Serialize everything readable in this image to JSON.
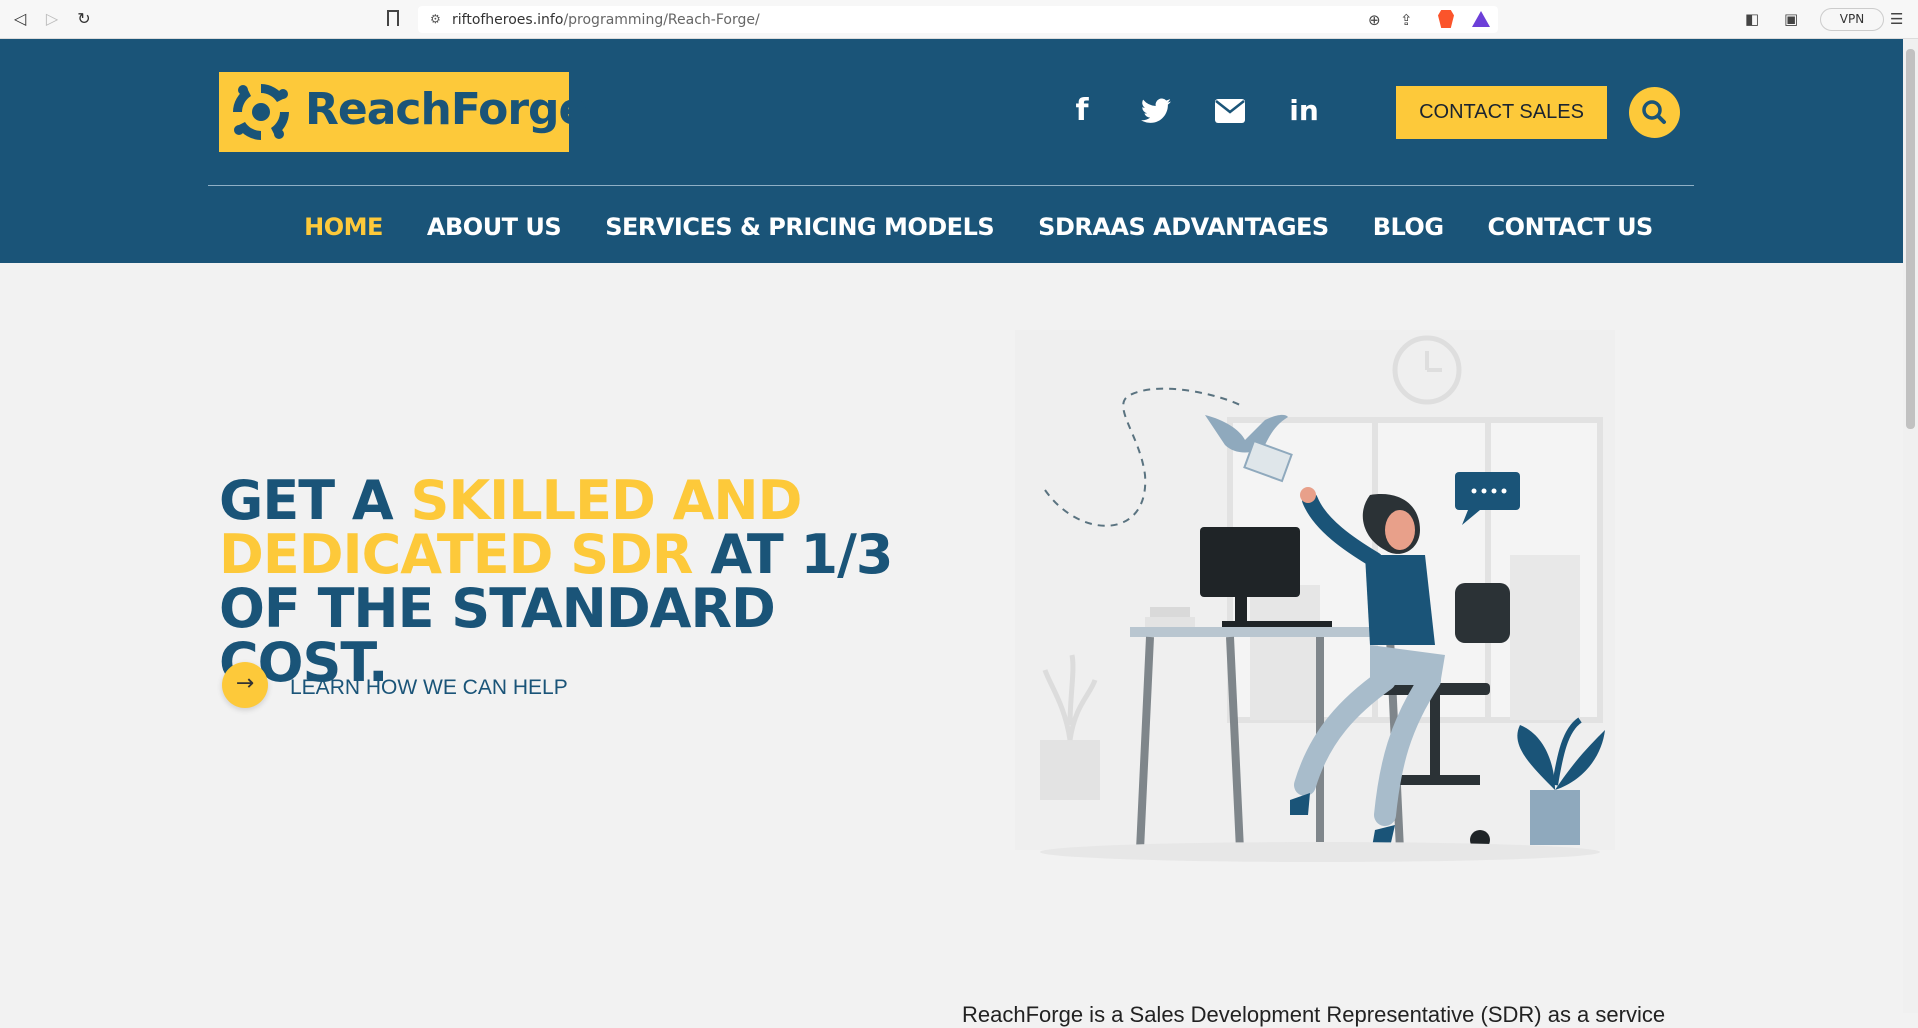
{
  "browser": {
    "url_host": "riftofheroes.info",
    "url_path": "/programming/Reach-Forge/",
    "vpn_label": "VPN"
  },
  "header": {
    "logo_text": "ReachForge",
    "contact_sales_label": "CONTACT SALES",
    "social_icons": [
      "facebook-icon",
      "twitter-icon",
      "email-icon",
      "linkedin-icon"
    ]
  },
  "nav": {
    "items": [
      {
        "label": "HOME",
        "active": true
      },
      {
        "label": "ABOUT US"
      },
      {
        "label": "SERVICES & PRICING MODELS"
      },
      {
        "label": "SDRAAS ADVANTAGES"
      },
      {
        "label": "BLOG"
      },
      {
        "label": "CONTACT US"
      }
    ]
  },
  "hero": {
    "title_part1": "GET A ",
    "title_highlight": "SKILLED AND DEDICATED SDR",
    "title_part2": " AT 1/3 OF THE STANDARD COST.",
    "cta_label": "LEARN HOW WE CAN HELP"
  },
  "bottom": {
    "partial_text": "ReachForge is a Sales Development Representative (SDR) as a service"
  },
  "colors": {
    "brand_blue": "#1a5478",
    "accent_yellow": "#fdc93a",
    "background": "#f2f2f2"
  }
}
